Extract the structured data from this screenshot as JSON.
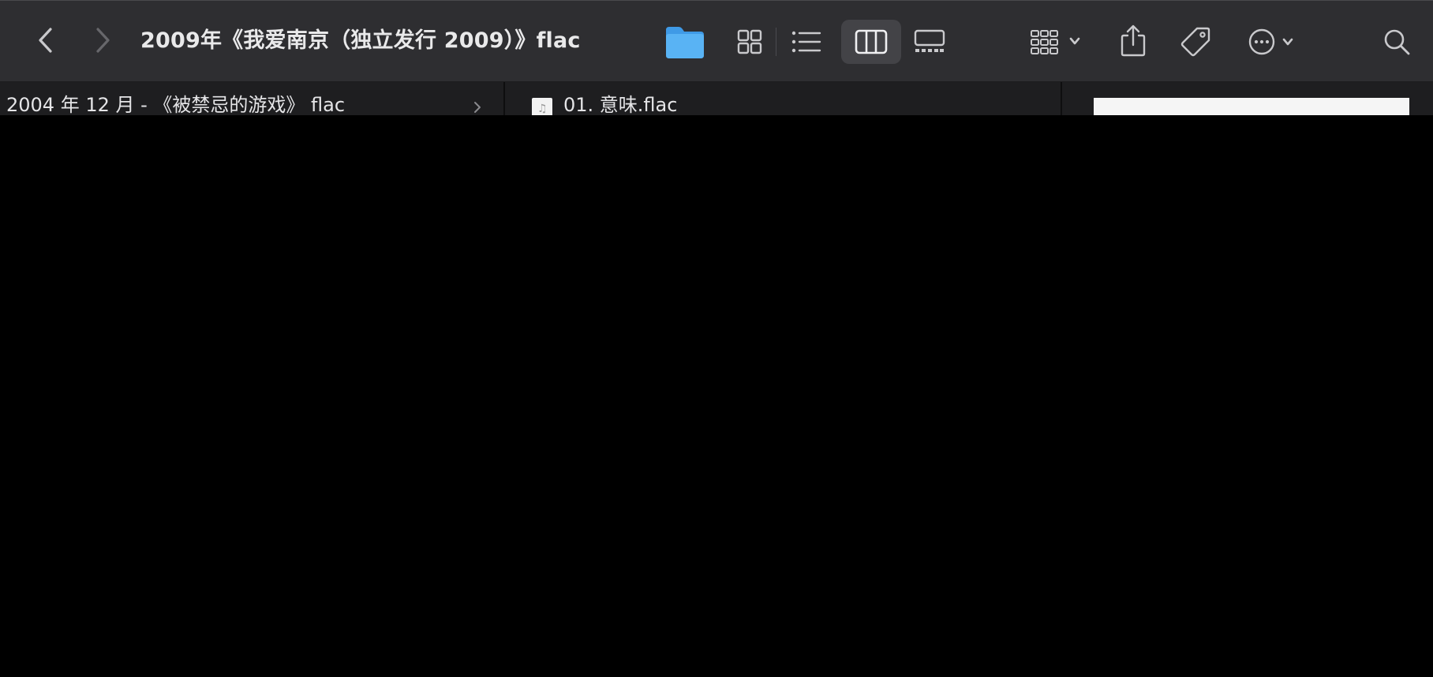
{
  "window": {
    "title": "2009年《我爱南京（独立发行 2009）》flac"
  },
  "toolbar": {
    "back_icon": "chevron-left-icon",
    "forward_icon": "chevron-right-icon",
    "folder_icon": "folder-icon",
    "views": [
      "icons",
      "list",
      "columns",
      "gallery"
    ],
    "active_view": "columns",
    "group_icon": "group-by-icon",
    "share_icon": "share-icon",
    "tag_icon": "tag-icon",
    "more_icon": "ellipsis-circle-icon",
    "search_icon": "search-icon",
    "colors": {
      "folder": "#4aa8f0",
      "active_view_bg": "#434347"
    }
  },
  "columns": {
    "col1": {
      "items": [
        {
          "label": "2004 年 12 月 - 《被禁忌的游戏》 flac",
          "has_children": true
        }
      ]
    },
    "col2": {
      "items": [
        {
          "label": "01. 意味.flac",
          "icon": "audio-file-icon"
        }
      ]
    }
  }
}
